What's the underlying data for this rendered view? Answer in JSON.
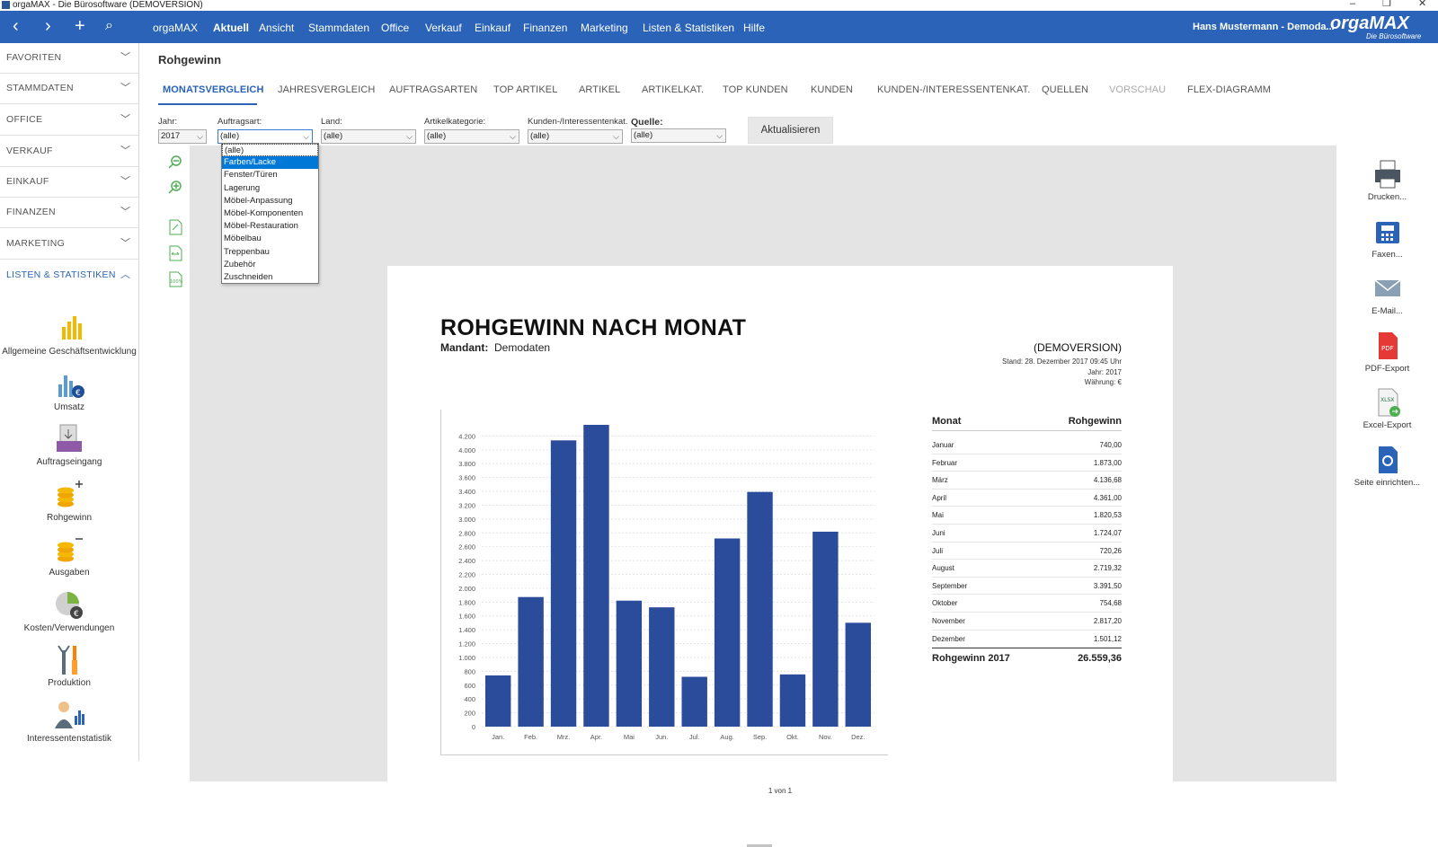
{
  "window": {
    "title": "orgaMAX - Die Bürosoftware (DEMOVERSION)"
  },
  "menu": {
    "items": [
      "orgaMAX",
      "Aktuell",
      "Ansicht",
      "Stammdaten",
      "Office",
      "Verkauf",
      "Einkauf",
      "Finanzen",
      "Marketing",
      "Listen & Statistiken",
      "Hilfe"
    ],
    "active": "Aktuell",
    "user": "Hans Mustermann - Demoda...",
    "logo": "orgaMAX",
    "logo_sub": "Die Bürosoftware"
  },
  "sidebar": {
    "sections": [
      "FAVORITEN",
      "STAMMDATEN",
      "OFFICE",
      "VERKAUF",
      "EINKAUF",
      "FINANZEN",
      "MARKETING",
      "LISTEN & STATISTIKEN"
    ],
    "items": [
      "Allgemeine Geschäftsentwicklung",
      "Umsatz",
      "Auftragseingang",
      "Rohgewinn",
      "Ausgaben",
      "Kosten/Verwendungen",
      "Produktion",
      "Interessentenstatistik"
    ]
  },
  "page": {
    "title": "Rohgewinn"
  },
  "tabs": [
    "MONATSVERGLEICH",
    "JAHRESVERGLEICH",
    "AUFTRAGSARTEN",
    "TOP ARTIKEL",
    "ARTIKEL",
    "ARTIKELKAT.",
    "TOP KUNDEN",
    "KUNDEN",
    "KUNDEN-/INTERESSENTENKAT.",
    "QUELLEN",
    "VORSCHAU",
    "FLEX-DIAGRAMM"
  ],
  "filters": {
    "jahr": {
      "label": "Jahr:",
      "value": "2017"
    },
    "auftragsart": {
      "label": "Auftragsart:",
      "value": "(alle)"
    },
    "land": {
      "label": "Land:",
      "value": "(alle)"
    },
    "artikelkategorie": {
      "label": "Artikelkategorie:",
      "value": "(alle)"
    },
    "kundenkat": {
      "label": "Kunden-/Interessentenkat.",
      "value": "(alle)"
    },
    "quelle": {
      "label": "Quelle:",
      "value": "(alle)"
    },
    "refresh": "Aktualisieren"
  },
  "dropdown": {
    "options": [
      "(alle)",
      "Farben/Lacke",
      "Fenster/Türen",
      "Lagerung",
      "Möbel-Anpassung",
      "Möbel-Komponenten",
      "Möbel-Restauration",
      "Möbelbau",
      "Treppenbau",
      "Zubehör",
      "Zuschneiden"
    ],
    "highlighted": "Farben/Lacke"
  },
  "report": {
    "title": "ROHGEWINN NACH MONAT",
    "mandant_label": "Mandant:",
    "mandant_value": "Demodaten",
    "demo": "(DEMOVERSION)",
    "stand": "Stand:  28. Dezember 2017 09:45 Uhr",
    "jahr": "Jahr: 2017",
    "waehrung": "Währung: €",
    "table_header_month": "Monat",
    "table_header_value": "Rohgewinn",
    "rows": [
      {
        "month": "Januar",
        "value": "740,00"
      },
      {
        "month": "Februar",
        "value": "1.873,00"
      },
      {
        "month": "März",
        "value": "4.136,68"
      },
      {
        "month": "April",
        "value": "4.361,00"
      },
      {
        "month": "Mai",
        "value": "1.820,53"
      },
      {
        "month": "Juni",
        "value": "1.724,07"
      },
      {
        "month": "Juli",
        "value": "720,26"
      },
      {
        "month": "August",
        "value": "2.719,32"
      },
      {
        "month": "September",
        "value": "3.391,50"
      },
      {
        "month": "Oktober",
        "value": "754,68"
      },
      {
        "month": "November",
        "value": "2.817,20"
      },
      {
        "month": "Dezember",
        "value": "1.501,12"
      }
    ],
    "total_label": "Rohgewinn 2017",
    "total_value": "26.559,36",
    "pager": "1 von 1"
  },
  "chart_data": {
    "type": "bar",
    "categories": [
      "Jan.",
      "Feb.",
      "Mrz.",
      "Apr.",
      "Mai",
      "Jun.",
      "Jul.",
      "Aug.",
      "Sep.",
      "Okt.",
      "Nov.",
      "Dez."
    ],
    "values": [
      740.0,
      1873.0,
      4136.68,
      4361.0,
      1820.53,
      1724.07,
      720.26,
      2719.32,
      3391.5,
      754.68,
      2817.2,
      1501.12
    ],
    "yticks": [
      "0",
      "200",
      "400",
      "600",
      "800",
      "1.000",
      "1.200",
      "1.400",
      "1.600",
      "1.800",
      "2.000",
      "2.200",
      "2.400",
      "2.600",
      "2.800",
      "3.000",
      "3.200",
      "3.400",
      "3.600",
      "3.800",
      "4.000",
      "4.200"
    ],
    "ylim": [
      0,
      4400
    ],
    "grid": true,
    "color": "#2b4b9b"
  },
  "right_tools": [
    "Drucken...",
    "Faxen...",
    "E-Mail...",
    "PDF-Export",
    "Excel-Export",
    "Seite einrichten..."
  ],
  "colors": {
    "accent": "#2a63b8",
    "bar": "#2b4b9b"
  }
}
